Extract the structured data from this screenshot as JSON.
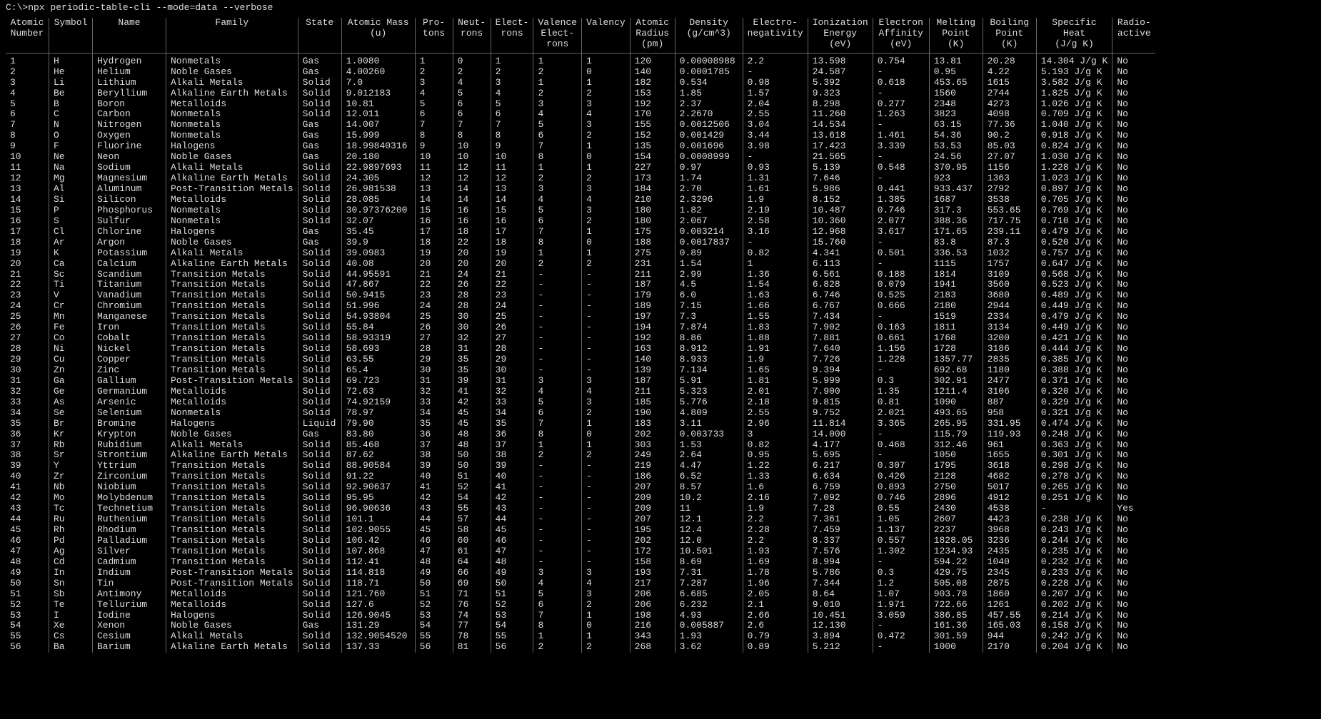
{
  "prompt": "C:\\>npx periodic-table-cli --mode=data --verbose",
  "headers": [
    "Atomic\nNumber",
    "Symbol",
    "Name",
    "Family",
    "State",
    "Atomic Mass\n(u)",
    "Pro-\ntons",
    "Neut-\nrons",
    "Elect-\nrons",
    "Valence\nElect-\nrons",
    "Valency",
    "Atomic\nRadius\n(pm)",
    "Density\n(g/cm^3)",
    "Electro-\nnegativity",
    "Ionization\nEnergy\n(eV)",
    "Electron\nAffinity\n(eV)",
    "Melting\nPoint\n(K)",
    "Boiling\nPoint\n(K)",
    "Specific\nHeat\n(J/g K)",
    "Radio-\nactive"
  ],
  "rows": [
    [
      "1",
      "H",
      "Hydrogen",
      "Nonmetals",
      "Gas",
      "1.0080",
      "1",
      "0",
      "1",
      "1",
      "1",
      "120",
      "0.00008988",
      "2.2",
      "13.598",
      "0.754",
      "13.81",
      "20.28",
      "14.304 J/g K",
      "No"
    ],
    [
      "2",
      "He",
      "Helium",
      "Noble Gases",
      "Gas",
      "4.00260",
      "2",
      "2",
      "2",
      "2",
      "0",
      "140",
      "0.0001785",
      "-",
      "24.587",
      "-",
      "0.95",
      "4.22",
      "5.193 J/g K",
      "No"
    ],
    [
      "3",
      "Li",
      "Lithium",
      "Alkali Metals",
      "Solid",
      "7.0",
      "3",
      "4",
      "3",
      "1",
      "1",
      "182",
      "0.534",
      "0.98",
      "5.392",
      "0.618",
      "453.65",
      "1615",
      "3.582 J/g K",
      "No"
    ],
    [
      "4",
      "Be",
      "Beryllium",
      "Alkaline Earth Metals",
      "Solid",
      "9.012183",
      "4",
      "5",
      "4",
      "2",
      "2",
      "153",
      "1.85",
      "1.57",
      "9.323",
      "-",
      "1560",
      "2744",
      "1.825 J/g K",
      "No"
    ],
    [
      "5",
      "B",
      "Boron",
      "Metalloids",
      "Solid",
      "10.81",
      "5",
      "6",
      "5",
      "3",
      "3",
      "192",
      "2.37",
      "2.04",
      "8.298",
      "0.277",
      "2348",
      "4273",
      "1.026 J/g K",
      "No"
    ],
    [
      "6",
      "C",
      "Carbon",
      "Nonmetals",
      "Solid",
      "12.011",
      "6",
      "6",
      "6",
      "4",
      "4",
      "170",
      "2.2670",
      "2.55",
      "11.260",
      "1.263",
      "3823",
      "4098",
      "0.709 J/g K",
      "No"
    ],
    [
      "7",
      "N",
      "Nitrogen",
      "Nonmetals",
      "Gas",
      "14.007",
      "7",
      "7",
      "7",
      "5",
      "3",
      "155",
      "0.0012506",
      "3.04",
      "14.534",
      "-",
      "63.15",
      "77.36",
      "1.040 J/g K",
      "No"
    ],
    [
      "8",
      "O",
      "Oxygen",
      "Nonmetals",
      "Gas",
      "15.999",
      "8",
      "8",
      "8",
      "6",
      "2",
      "152",
      "0.001429",
      "3.44",
      "13.618",
      "1.461",
      "54.36",
      "90.2",
      "0.918 J/g K",
      "No"
    ],
    [
      "9",
      "F",
      "Fluorine",
      "Halogens",
      "Gas",
      "18.99840316",
      "9",
      "10",
      "9",
      "7",
      "1",
      "135",
      "0.001696",
      "3.98",
      "17.423",
      "3.339",
      "53.53",
      "85.03",
      "0.824 J/g K",
      "No"
    ],
    [
      "10",
      "Ne",
      "Neon",
      "Noble Gases",
      "Gas",
      "20.180",
      "10",
      "10",
      "10",
      "8",
      "0",
      "154",
      "0.0008999",
      "-",
      "21.565",
      "-",
      "24.56",
      "27.07",
      "1.030 J/g K",
      "No"
    ],
    [
      "11",
      "Na",
      "Sodium",
      "Alkali Metals",
      "Solid",
      "22.9897693",
      "11",
      "12",
      "11",
      "1",
      "1",
      "227",
      "0.97",
      "0.93",
      "5.139",
      "0.548",
      "370.95",
      "1156",
      "1.228 J/g K",
      "No"
    ],
    [
      "12",
      "Mg",
      "Magnesium",
      "Alkaline Earth Metals",
      "Solid",
      "24.305",
      "12",
      "12",
      "12",
      "2",
      "2",
      "173",
      "1.74",
      "1.31",
      "7.646",
      "-",
      "923",
      "1363",
      "1.023 J/g K",
      "No"
    ],
    [
      "13",
      "Al",
      "Aluminum",
      "Post-Transition Metals",
      "Solid",
      "26.981538",
      "13",
      "14",
      "13",
      "3",
      "3",
      "184",
      "2.70",
      "1.61",
      "5.986",
      "0.441",
      "933.437",
      "2792",
      "0.897 J/g K",
      "No"
    ],
    [
      "14",
      "Si",
      "Silicon",
      "Metalloids",
      "Solid",
      "28.085",
      "14",
      "14",
      "14",
      "4",
      "4",
      "210",
      "2.3296",
      "1.9",
      "8.152",
      "1.385",
      "1687",
      "3538",
      "0.705 J/g K",
      "No"
    ],
    [
      "15",
      "P",
      "Phosphorus",
      "Nonmetals",
      "Solid",
      "30.97376200",
      "15",
      "16",
      "15",
      "5",
      "3",
      "180",
      "1.82",
      "2.19",
      "10.487",
      "0.746",
      "317.3",
      "553.65",
      "0.769 J/g K",
      "No"
    ],
    [
      "16",
      "S",
      "Sulfur",
      "Nonmetals",
      "Solid",
      "32.07",
      "16",
      "16",
      "16",
      "6",
      "2",
      "180",
      "2.067",
      "2.58",
      "10.360",
      "2.077",
      "388.36",
      "717.75",
      "0.710 J/g K",
      "No"
    ],
    [
      "17",
      "Cl",
      "Chlorine",
      "Halogens",
      "Gas",
      "35.45",
      "17",
      "18",
      "17",
      "7",
      "1",
      "175",
      "0.003214",
      "3.16",
      "12.968",
      "3.617",
      "171.65",
      "239.11",
      "0.479 J/g K",
      "No"
    ],
    [
      "18",
      "Ar",
      "Argon",
      "Noble Gases",
      "Gas",
      "39.9",
      "18",
      "22",
      "18",
      "8",
      "0",
      "188",
      "0.0017837",
      "-",
      "15.760",
      "-",
      "83.8",
      "87.3",
      "0.520 J/g K",
      "No"
    ],
    [
      "19",
      "K",
      "Potassium",
      "Alkali Metals",
      "Solid",
      "39.0983",
      "19",
      "20",
      "19",
      "1",
      "1",
      "275",
      "0.89",
      "0.82",
      "4.341",
      "0.501",
      "336.53",
      "1032",
      "0.757 J/g K",
      "No"
    ],
    [
      "20",
      "Ca",
      "Calcium",
      "Alkaline Earth Metals",
      "Solid",
      "40.08",
      "20",
      "20",
      "20",
      "2",
      "2",
      "231",
      "1.54",
      "1",
      "6.113",
      "-",
      "1115",
      "1757",
      "0.647 J/g K",
      "No"
    ],
    [
      "21",
      "Sc",
      "Scandium",
      "Transition Metals",
      "Solid",
      "44.95591",
      "21",
      "24",
      "21",
      "-",
      "-",
      "211",
      "2.99",
      "1.36",
      "6.561",
      "0.188",
      "1814",
      "3109",
      "0.568 J/g K",
      "No"
    ],
    [
      "22",
      "Ti",
      "Titanium",
      "Transition Metals",
      "Solid",
      "47.867",
      "22",
      "26",
      "22",
      "-",
      "-",
      "187",
      "4.5",
      "1.54",
      "6.828",
      "0.079",
      "1941",
      "3560",
      "0.523 J/g K",
      "No"
    ],
    [
      "23",
      "V",
      "Vanadium",
      "Transition Metals",
      "Solid",
      "50.9415",
      "23",
      "28",
      "23",
      "-",
      "-",
      "179",
      "6.0",
      "1.63",
      "6.746",
      "0.525",
      "2183",
      "3680",
      "0.489 J/g K",
      "No"
    ],
    [
      "24",
      "Cr",
      "Chromium",
      "Transition Metals",
      "Solid",
      "51.996",
      "24",
      "28",
      "24",
      "-",
      "-",
      "189",
      "7.15",
      "1.66",
      "6.767",
      "0.666",
      "2180",
      "2944",
      "0.449 J/g K",
      "No"
    ],
    [
      "25",
      "Mn",
      "Manganese",
      "Transition Metals",
      "Solid",
      "54.93804",
      "25",
      "30",
      "25",
      "-",
      "-",
      "197",
      "7.3",
      "1.55",
      "7.434",
      "-",
      "1519",
      "2334",
      "0.479 J/g K",
      "No"
    ],
    [
      "26",
      "Fe",
      "Iron",
      "Transition Metals",
      "Solid",
      "55.84",
      "26",
      "30",
      "26",
      "-",
      "-",
      "194",
      "7.874",
      "1.83",
      "7.902",
      "0.163",
      "1811",
      "3134",
      "0.449 J/g K",
      "No"
    ],
    [
      "27",
      "Co",
      "Cobalt",
      "Transition Metals",
      "Solid",
      "58.93319",
      "27",
      "32",
      "27",
      "-",
      "-",
      "192",
      "8.86",
      "1.88",
      "7.881",
      "0.661",
      "1768",
      "3200",
      "0.421 J/g K",
      "No"
    ],
    [
      "28",
      "Ni",
      "Nickel",
      "Transition Metals",
      "Solid",
      "58.693",
      "28",
      "31",
      "28",
      "-",
      "-",
      "163",
      "8.912",
      "1.91",
      "7.640",
      "1.156",
      "1728",
      "3186",
      "0.444 J/g K",
      "No"
    ],
    [
      "29",
      "Cu",
      "Copper",
      "Transition Metals",
      "Solid",
      "63.55",
      "29",
      "35",
      "29",
      "-",
      "-",
      "140",
      "8.933",
      "1.9",
      "7.726",
      "1.228",
      "1357.77",
      "2835",
      "0.385 J/g K",
      "No"
    ],
    [
      "30",
      "Zn",
      "Zinc",
      "Transition Metals",
      "Solid",
      "65.4",
      "30",
      "35",
      "30",
      "-",
      "-",
      "139",
      "7.134",
      "1.65",
      "9.394",
      "-",
      "692.68",
      "1180",
      "0.388 J/g K",
      "No"
    ],
    [
      "31",
      "Ga",
      "Gallium",
      "Post-Transition Metals",
      "Solid",
      "69.723",
      "31",
      "39",
      "31",
      "3",
      "3",
      "187",
      "5.91",
      "1.81",
      "5.999",
      "0.3",
      "302.91",
      "2477",
      "0.371 J/g K",
      "No"
    ],
    [
      "32",
      "Ge",
      "Germanium",
      "Metalloids",
      "Solid",
      "72.63",
      "32",
      "41",
      "32",
      "4",
      "4",
      "211",
      "5.323",
      "2.01",
      "7.900",
      "1.35",
      "1211.4",
      "3106",
      "0.320 J/g K",
      "No"
    ],
    [
      "33",
      "As",
      "Arsenic",
      "Metalloids",
      "Solid",
      "74.92159",
      "33",
      "42",
      "33",
      "5",
      "3",
      "185",
      "5.776",
      "2.18",
      "9.815",
      "0.81",
      "1090",
      "887",
      "0.329 J/g K",
      "No"
    ],
    [
      "34",
      "Se",
      "Selenium",
      "Nonmetals",
      "Solid",
      "78.97",
      "34",
      "45",
      "34",
      "6",
      "2",
      "190",
      "4.809",
      "2.55",
      "9.752",
      "2.021",
      "493.65",
      "958",
      "0.321 J/g K",
      "No"
    ],
    [
      "35",
      "Br",
      "Bromine",
      "Halogens",
      "Liquid",
      "79.90",
      "35",
      "45",
      "35",
      "7",
      "1",
      "183",
      "3.11",
      "2.96",
      "11.814",
      "3.365",
      "265.95",
      "331.95",
      "0.474 J/g K",
      "No"
    ],
    [
      "36",
      "Kr",
      "Krypton",
      "Noble Gases",
      "Gas",
      "83.80",
      "36",
      "48",
      "36",
      "8",
      "0",
      "202",
      "0.003733",
      "3",
      "14.000",
      "-",
      "115.79",
      "119.93",
      "0.248 J/g K",
      "No"
    ],
    [
      "37",
      "Rb",
      "Rubidium",
      "Alkali Metals",
      "Solid",
      "85.468",
      "37",
      "48",
      "37",
      "1",
      "1",
      "303",
      "1.53",
      "0.82",
      "4.177",
      "0.468",
      "312.46",
      "961",
      "0.363 J/g K",
      "No"
    ],
    [
      "38",
      "Sr",
      "Strontium",
      "Alkaline Earth Metals",
      "Solid",
      "87.62",
      "38",
      "50",
      "38",
      "2",
      "2",
      "249",
      "2.64",
      "0.95",
      "5.695",
      "-",
      "1050",
      "1655",
      "0.301 J/g K",
      "No"
    ],
    [
      "39",
      "Y",
      "Yttrium",
      "Transition Metals",
      "Solid",
      "88.90584",
      "39",
      "50",
      "39",
      "-",
      "-",
      "219",
      "4.47",
      "1.22",
      "6.217",
      "0.307",
      "1795",
      "3618",
      "0.298 J/g K",
      "No"
    ],
    [
      "40",
      "Zr",
      "Zirconium",
      "Transition Metals",
      "Solid",
      "91.22",
      "40",
      "51",
      "40",
      "-",
      "-",
      "186",
      "6.52",
      "1.33",
      "6.634",
      "0.426",
      "2128",
      "4682",
      "0.278 J/g K",
      "No"
    ],
    [
      "41",
      "Nb",
      "Niobium",
      "Transition Metals",
      "Solid",
      "92.90637",
      "41",
      "52",
      "41",
      "-",
      "-",
      "207",
      "8.57",
      "1.6",
      "6.759",
      "0.893",
      "2750",
      "5017",
      "0.265 J/g K",
      "No"
    ],
    [
      "42",
      "Mo",
      "Molybdenum",
      "Transition Metals",
      "Solid",
      "95.95",
      "42",
      "54",
      "42",
      "-",
      "-",
      "209",
      "10.2",
      "2.16",
      "7.092",
      "0.746",
      "2896",
      "4912",
      "0.251 J/g K",
      "No"
    ],
    [
      "43",
      "Tc",
      "Technetium",
      "Transition Metals",
      "Solid",
      "96.90636",
      "43",
      "55",
      "43",
      "-",
      "-",
      "209",
      "11",
      "1.9",
      "7.28",
      "0.55",
      "2430",
      "4538",
      "-",
      "Yes"
    ],
    [
      "44",
      "Ru",
      "Ruthenium",
      "Transition Metals",
      "Solid",
      "101.1",
      "44",
      "57",
      "44",
      "-",
      "-",
      "207",
      "12.1",
      "2.2",
      "7.361",
      "1.05",
      "2607",
      "4423",
      "0.238 J/g K",
      "No"
    ],
    [
      "45",
      "Rh",
      "Rhodium",
      "Transition Metals",
      "Solid",
      "102.9055",
      "45",
      "58",
      "45",
      "-",
      "-",
      "195",
      "12.4",
      "2.28",
      "7.459",
      "1.137",
      "2237",
      "3968",
      "0.243 J/g K",
      "No"
    ],
    [
      "46",
      "Pd",
      "Palladium",
      "Transition Metals",
      "Solid",
      "106.42",
      "46",
      "60",
      "46",
      "-",
      "-",
      "202",
      "12.0",
      "2.2",
      "8.337",
      "0.557",
      "1828.05",
      "3236",
      "0.244 J/g K",
      "No"
    ],
    [
      "47",
      "Ag",
      "Silver",
      "Transition Metals",
      "Solid",
      "107.868",
      "47",
      "61",
      "47",
      "-",
      "-",
      "172",
      "10.501",
      "1.93",
      "7.576",
      "1.302",
      "1234.93",
      "2435",
      "0.235 J/g K",
      "No"
    ],
    [
      "48",
      "Cd",
      "Cadmium",
      "Transition Metals",
      "Solid",
      "112.41",
      "48",
      "64",
      "48",
      "-",
      "-",
      "158",
      "8.69",
      "1.69",
      "8.994",
      "-",
      "594.22",
      "1040",
      "0.232 J/g K",
      "No"
    ],
    [
      "49",
      "In",
      "Indium",
      "Post-Transition Metals",
      "Solid",
      "114.818",
      "49",
      "66",
      "49",
      "3",
      "3",
      "193",
      "7.31",
      "1.78",
      "5.786",
      "0.3",
      "429.75",
      "2345",
      "0.233 J/g K",
      "No"
    ],
    [
      "50",
      "Sn",
      "Tin",
      "Post-Transition Metals",
      "Solid",
      "118.71",
      "50",
      "69",
      "50",
      "4",
      "4",
      "217",
      "7.287",
      "1.96",
      "7.344",
      "1.2",
      "505.08",
      "2875",
      "0.228 J/g K",
      "No"
    ],
    [
      "51",
      "Sb",
      "Antimony",
      "Metalloids",
      "Solid",
      "121.760",
      "51",
      "71",
      "51",
      "5",
      "3",
      "206",
      "6.685",
      "2.05",
      "8.64",
      "1.07",
      "903.78",
      "1860",
      "0.207 J/g K",
      "No"
    ],
    [
      "52",
      "Te",
      "Tellurium",
      "Metalloids",
      "Solid",
      "127.6",
      "52",
      "76",
      "52",
      "6",
      "2",
      "206",
      "6.232",
      "2.1",
      "9.010",
      "1.971",
      "722.66",
      "1261",
      "0.202 J/g K",
      "No"
    ],
    [
      "53",
      "I",
      "Iodine",
      "Halogens",
      "Solid",
      "126.9045",
      "53",
      "74",
      "53",
      "7",
      "1",
      "198",
      "4.93",
      "2.66",
      "10.451",
      "3.059",
      "386.85",
      "457.55",
      "0.214 J/g K",
      "No"
    ],
    [
      "54",
      "Xe",
      "Xenon",
      "Noble Gases",
      "Gas",
      "131.29",
      "54",
      "77",
      "54",
      "8",
      "0",
      "216",
      "0.005887",
      "2.6",
      "12.130",
      "-",
      "161.36",
      "165.03",
      "0.158 J/g K",
      "No"
    ],
    [
      "55",
      "Cs",
      "Cesium",
      "Alkali Metals",
      "Solid",
      "132.9054520",
      "55",
      "78",
      "55",
      "1",
      "1",
      "343",
      "1.93",
      "0.79",
      "3.894",
      "0.472",
      "301.59",
      "944",
      "0.242 J/g K",
      "No"
    ],
    [
      "56",
      "Ba",
      "Barium",
      "Alkaline Earth Metals",
      "Solid",
      "137.33",
      "56",
      "81",
      "56",
      "2",
      "2",
      "268",
      "3.62",
      "0.89",
      "5.212",
      "-",
      "1000",
      "2170",
      "0.204 J/g K",
      "No"
    ]
  ]
}
